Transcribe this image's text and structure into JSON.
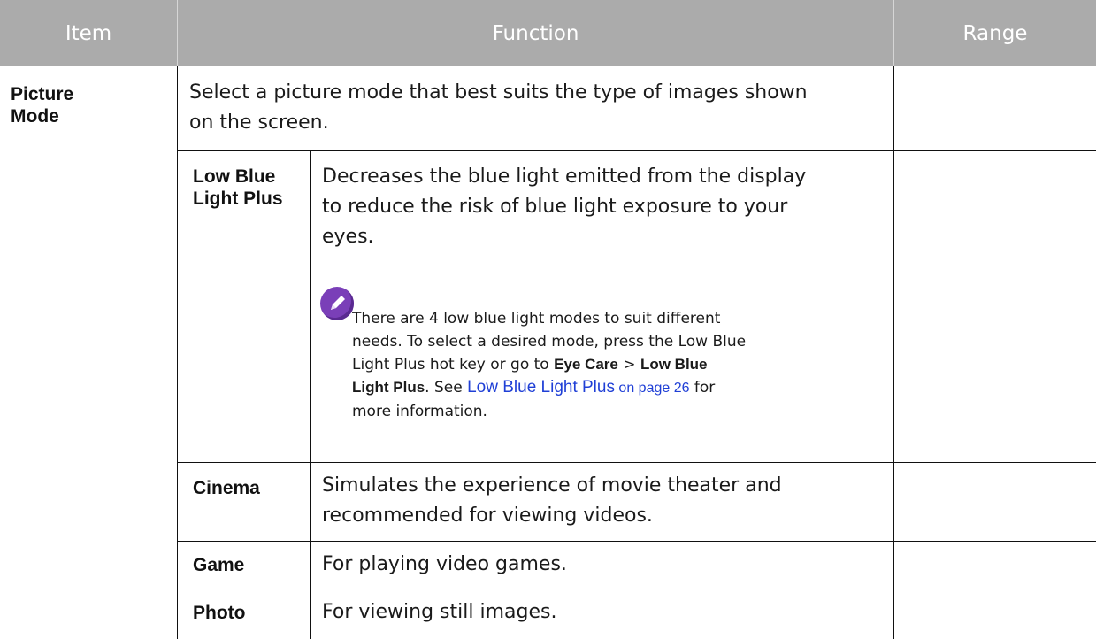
{
  "header": {
    "item": "Item",
    "function": "Function",
    "range": "Range"
  },
  "colors": {
    "header_bg": "#ababab",
    "header_text": "#ffffff",
    "link": "#1f3fd6",
    "note_icon": "#7a3fb8"
  },
  "rows": {
    "picture_mode": {
      "item_line1": "Picture",
      "item_line2": "Mode",
      "desc_line1": "Select a picture mode that best suits the type of images shown",
      "desc_line2": "on the screen."
    },
    "low_blue": {
      "label_line1": "Low Blue",
      "label_line2": "Light Plus",
      "desc_line1": "Decreases the blue light emitted from the display",
      "desc_line2": "to reduce the risk of blue light exposure to your",
      "desc_line3": "eyes.",
      "note_icon": "pencil-note-icon",
      "note_line1": "There are 4 low blue light modes to suit different",
      "note_line2": "needs. To select a desired mode, press the Low Blue",
      "note_line3a": "Light Plus hot key or go to ",
      "note_bold1": "Eye Care",
      "note_sep": " > ",
      "note_bold2": "Low Blue",
      "note_bold3": "Light Plus",
      "note_line4a": ". See ",
      "note_link": "Low Blue Light Plus",
      "note_link_page": " on page 26",
      "note_line4b": " for",
      "note_line5": "more information."
    },
    "cinema": {
      "label": "Cinema",
      "desc_line1": "Simulates the experience of movie theater and",
      "desc_line2": "recommended for viewing videos."
    },
    "game": {
      "label": "Game",
      "desc": "For playing video games."
    },
    "photo": {
      "label": "Photo",
      "desc": "For viewing still images."
    }
  }
}
